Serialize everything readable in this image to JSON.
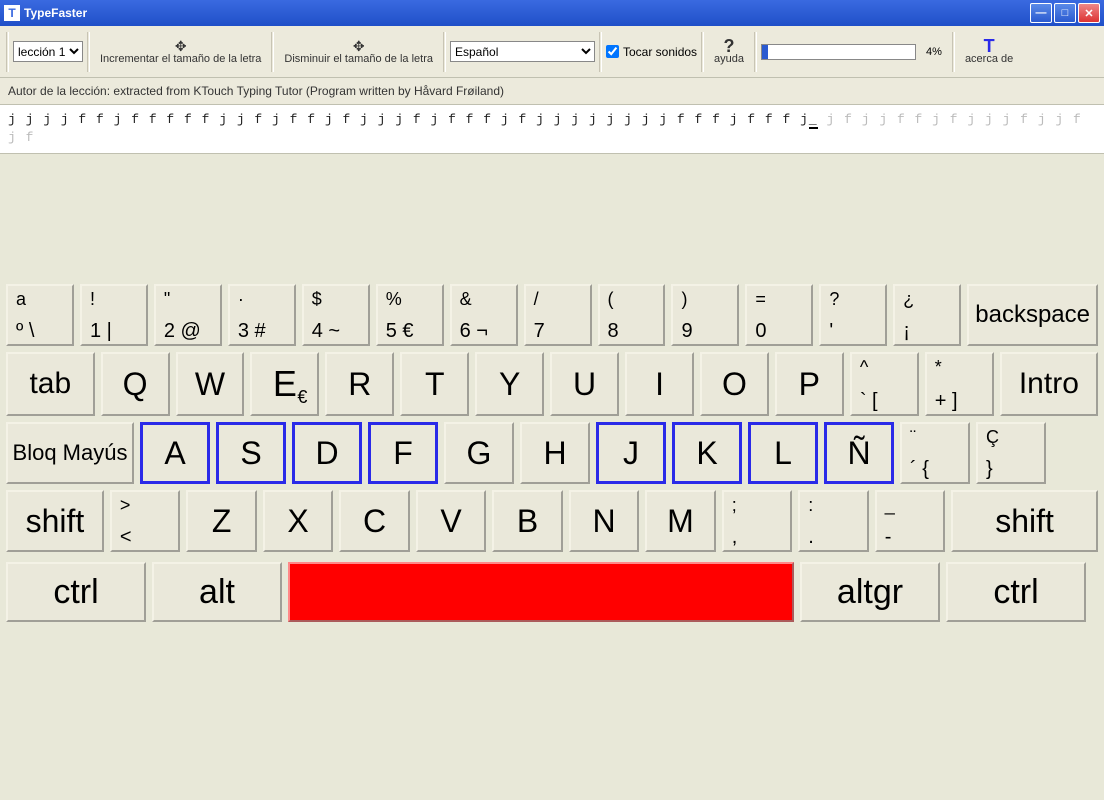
{
  "window": {
    "title": "TypeFaster"
  },
  "toolbar": {
    "lesson_selected": "lección 1",
    "increase_label": "Incrementar el tamaño de la letra",
    "decrease_label": "Disminuir el tamaño de la letra",
    "language_selected": "Español",
    "sounds_label": "Tocar sonidos",
    "sounds_checked": true,
    "help_label": "ayuda",
    "progress_pct": 4,
    "progress_text": "4%",
    "about_label": "acerca de"
  },
  "lesson": {
    "author_line": "Autor de la lección: extracted from KTouch Typing Tutor (Program written by Håvard Frøiland)",
    "text_typed": "j j    j j    f f    j    f f    f f    f j    j    f    j f f    j    f    j j    j f    j    f f    f    j f    j    j    j j    j j    j j    f    f f j    f    f f    j",
    "text_remaining": "    j    f    j j    f f    j    f    j j    j    f    j j    f    j    f",
    "cursor": "_"
  },
  "keys": {
    "r1": [
      {
        "t": "a",
        "b": "º \\"
      },
      {
        "t": "!",
        "b": "1 |"
      },
      {
        "t": "\"",
        "b": "2 @"
      },
      {
        "t": "·",
        "b": "3 #"
      },
      {
        "t": "$",
        "b": "4 ~"
      },
      {
        "t": "%",
        "b": "5 €"
      },
      {
        "t": "&",
        "b": "6 ¬"
      },
      {
        "t": "/",
        "b": "7"
      },
      {
        "t": "(",
        "b": "8"
      },
      {
        "t": ")",
        "b": "9"
      },
      {
        "t": "=",
        "b": "0"
      },
      {
        "t": "?",
        "b": "'"
      },
      {
        "t": "¿",
        "b": "¡"
      }
    ],
    "bksp": "backspace",
    "tab": "tab",
    "r2": [
      "Q",
      "W",
      "E",
      "R",
      "T",
      "Y",
      "U",
      "I",
      "O",
      "P"
    ],
    "r2e": {
      "t": "E",
      "s": "€"
    },
    "r2a": [
      {
        "t": "^",
        "b": "` ["
      },
      {
        "t": "*",
        "b": "+ ]"
      }
    ],
    "intro": "Intro",
    "caps": "Bloq Mayús",
    "r3": [
      "A",
      "S",
      "D",
      "F",
      "G",
      "H",
      "J",
      "K",
      "L",
      "Ñ"
    ],
    "r3a": [
      {
        "t": "¨",
        "b": "´ {"
      },
      {
        "t": "Ç",
        "b": "}"
      }
    ],
    "shift": "shift",
    "r4a": {
      "t": ">",
      "b": "<"
    },
    "r4": [
      "Z",
      "X",
      "C",
      "V",
      "B",
      "N",
      "M"
    ],
    "r4b": [
      {
        "t": ";",
        "b": ","
      },
      {
        "t": ":",
        "b": "."
      },
      {
        "t": "_",
        "b": "-"
      }
    ],
    "ctrl": "ctrl",
    "alt": "alt",
    "altgr": "altgr"
  }
}
